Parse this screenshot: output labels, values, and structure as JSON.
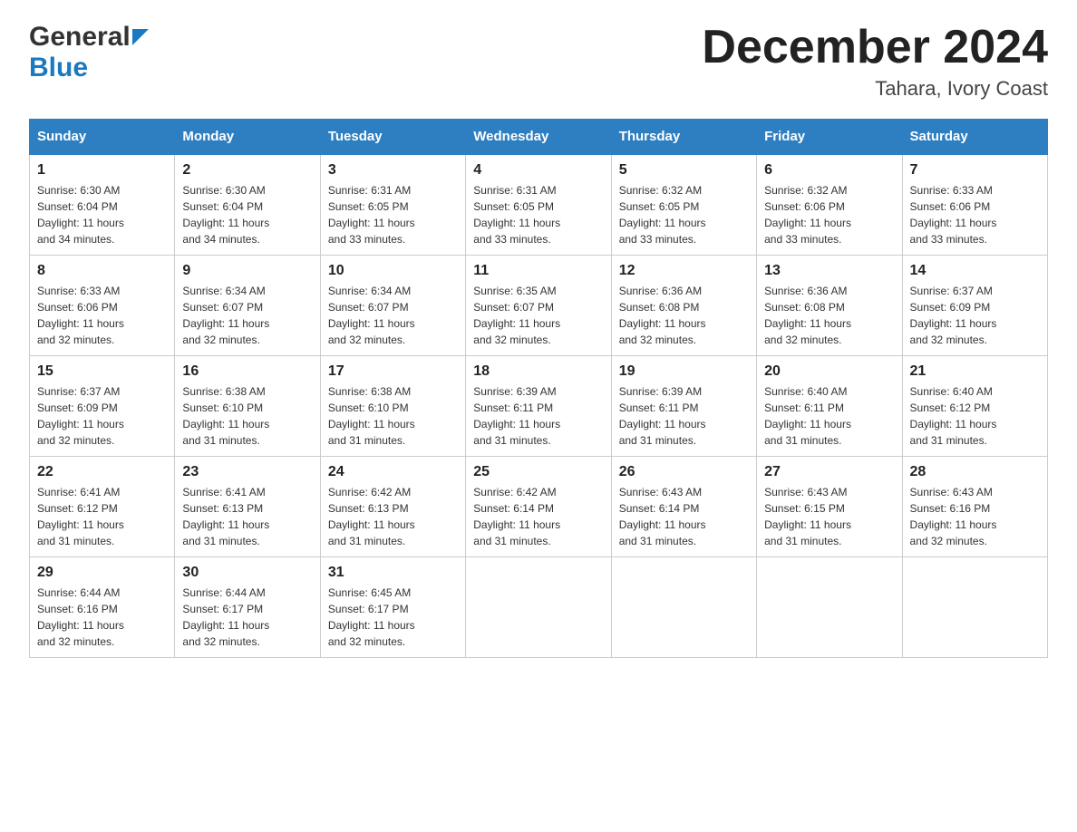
{
  "logo": {
    "general": "General",
    "blue": "Blue"
  },
  "title": {
    "month": "December 2024",
    "location": "Tahara, Ivory Coast"
  },
  "weekdays": [
    "Sunday",
    "Monday",
    "Tuesday",
    "Wednesday",
    "Thursday",
    "Friday",
    "Saturday"
  ],
  "weeks": [
    [
      {
        "day": "1",
        "info": "Sunrise: 6:30 AM\nSunset: 6:04 PM\nDaylight: 11 hours\nand 34 minutes."
      },
      {
        "day": "2",
        "info": "Sunrise: 6:30 AM\nSunset: 6:04 PM\nDaylight: 11 hours\nand 34 minutes."
      },
      {
        "day": "3",
        "info": "Sunrise: 6:31 AM\nSunset: 6:05 PM\nDaylight: 11 hours\nand 33 minutes."
      },
      {
        "day": "4",
        "info": "Sunrise: 6:31 AM\nSunset: 6:05 PM\nDaylight: 11 hours\nand 33 minutes."
      },
      {
        "day": "5",
        "info": "Sunrise: 6:32 AM\nSunset: 6:05 PM\nDaylight: 11 hours\nand 33 minutes."
      },
      {
        "day": "6",
        "info": "Sunrise: 6:32 AM\nSunset: 6:06 PM\nDaylight: 11 hours\nand 33 minutes."
      },
      {
        "day": "7",
        "info": "Sunrise: 6:33 AM\nSunset: 6:06 PM\nDaylight: 11 hours\nand 33 minutes."
      }
    ],
    [
      {
        "day": "8",
        "info": "Sunrise: 6:33 AM\nSunset: 6:06 PM\nDaylight: 11 hours\nand 32 minutes."
      },
      {
        "day": "9",
        "info": "Sunrise: 6:34 AM\nSunset: 6:07 PM\nDaylight: 11 hours\nand 32 minutes."
      },
      {
        "day": "10",
        "info": "Sunrise: 6:34 AM\nSunset: 6:07 PM\nDaylight: 11 hours\nand 32 minutes."
      },
      {
        "day": "11",
        "info": "Sunrise: 6:35 AM\nSunset: 6:07 PM\nDaylight: 11 hours\nand 32 minutes."
      },
      {
        "day": "12",
        "info": "Sunrise: 6:36 AM\nSunset: 6:08 PM\nDaylight: 11 hours\nand 32 minutes."
      },
      {
        "day": "13",
        "info": "Sunrise: 6:36 AM\nSunset: 6:08 PM\nDaylight: 11 hours\nand 32 minutes."
      },
      {
        "day": "14",
        "info": "Sunrise: 6:37 AM\nSunset: 6:09 PM\nDaylight: 11 hours\nand 32 minutes."
      }
    ],
    [
      {
        "day": "15",
        "info": "Sunrise: 6:37 AM\nSunset: 6:09 PM\nDaylight: 11 hours\nand 32 minutes."
      },
      {
        "day": "16",
        "info": "Sunrise: 6:38 AM\nSunset: 6:10 PM\nDaylight: 11 hours\nand 31 minutes."
      },
      {
        "day": "17",
        "info": "Sunrise: 6:38 AM\nSunset: 6:10 PM\nDaylight: 11 hours\nand 31 minutes."
      },
      {
        "day": "18",
        "info": "Sunrise: 6:39 AM\nSunset: 6:11 PM\nDaylight: 11 hours\nand 31 minutes."
      },
      {
        "day": "19",
        "info": "Sunrise: 6:39 AM\nSunset: 6:11 PM\nDaylight: 11 hours\nand 31 minutes."
      },
      {
        "day": "20",
        "info": "Sunrise: 6:40 AM\nSunset: 6:11 PM\nDaylight: 11 hours\nand 31 minutes."
      },
      {
        "day": "21",
        "info": "Sunrise: 6:40 AM\nSunset: 6:12 PM\nDaylight: 11 hours\nand 31 minutes."
      }
    ],
    [
      {
        "day": "22",
        "info": "Sunrise: 6:41 AM\nSunset: 6:12 PM\nDaylight: 11 hours\nand 31 minutes."
      },
      {
        "day": "23",
        "info": "Sunrise: 6:41 AM\nSunset: 6:13 PM\nDaylight: 11 hours\nand 31 minutes."
      },
      {
        "day": "24",
        "info": "Sunrise: 6:42 AM\nSunset: 6:13 PM\nDaylight: 11 hours\nand 31 minutes."
      },
      {
        "day": "25",
        "info": "Sunrise: 6:42 AM\nSunset: 6:14 PM\nDaylight: 11 hours\nand 31 minutes."
      },
      {
        "day": "26",
        "info": "Sunrise: 6:43 AM\nSunset: 6:14 PM\nDaylight: 11 hours\nand 31 minutes."
      },
      {
        "day": "27",
        "info": "Sunrise: 6:43 AM\nSunset: 6:15 PM\nDaylight: 11 hours\nand 31 minutes."
      },
      {
        "day": "28",
        "info": "Sunrise: 6:43 AM\nSunset: 6:16 PM\nDaylight: 11 hours\nand 32 minutes."
      }
    ],
    [
      {
        "day": "29",
        "info": "Sunrise: 6:44 AM\nSunset: 6:16 PM\nDaylight: 11 hours\nand 32 minutes."
      },
      {
        "day": "30",
        "info": "Sunrise: 6:44 AM\nSunset: 6:17 PM\nDaylight: 11 hours\nand 32 minutes."
      },
      {
        "day": "31",
        "info": "Sunrise: 6:45 AM\nSunset: 6:17 PM\nDaylight: 11 hours\nand 32 minutes."
      },
      {
        "day": "",
        "info": ""
      },
      {
        "day": "",
        "info": ""
      },
      {
        "day": "",
        "info": ""
      },
      {
        "day": "",
        "info": ""
      }
    ]
  ]
}
